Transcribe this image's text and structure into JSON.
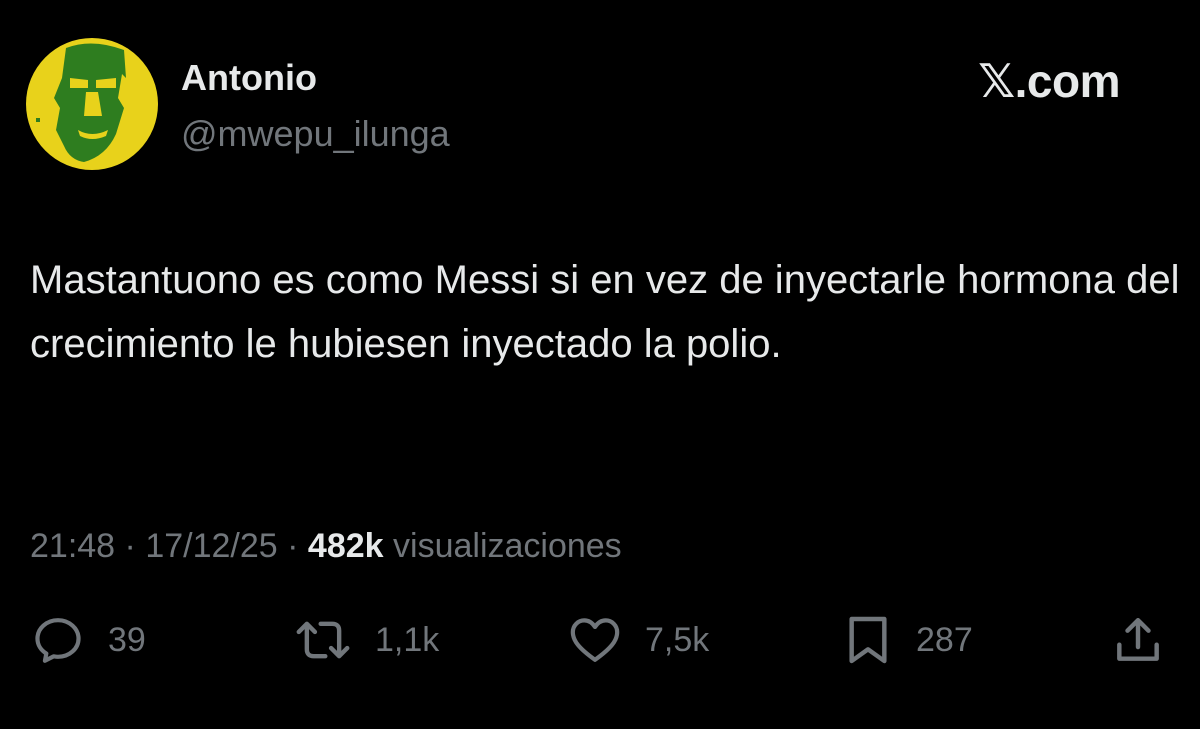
{
  "author": {
    "display_name": "Antonio",
    "handle": "@mwepu_ilunga",
    "avatar": "green-face-on-yellow-circle-avatar"
  },
  "brand": "𝕏.com",
  "tweet": {
    "text": "Mastantuono es como Messi si en vez de inyectarle hormona del crecimiento le hubiesen inyectado la polio."
  },
  "meta": {
    "time": "21:48",
    "separator": "·",
    "date": "17/12/25",
    "views_count": "482k",
    "views_label": "visualizaciones"
  },
  "actions": {
    "replies": "39",
    "reposts": "1,1k",
    "likes": "7,5k",
    "bookmarks": "287"
  },
  "colors": {
    "background": "#000000",
    "primary_text": "#e7e9ea",
    "secondary_text": "#71767b",
    "avatar_yellow": "#e8d21b",
    "avatar_green": "#2e7d1f"
  }
}
